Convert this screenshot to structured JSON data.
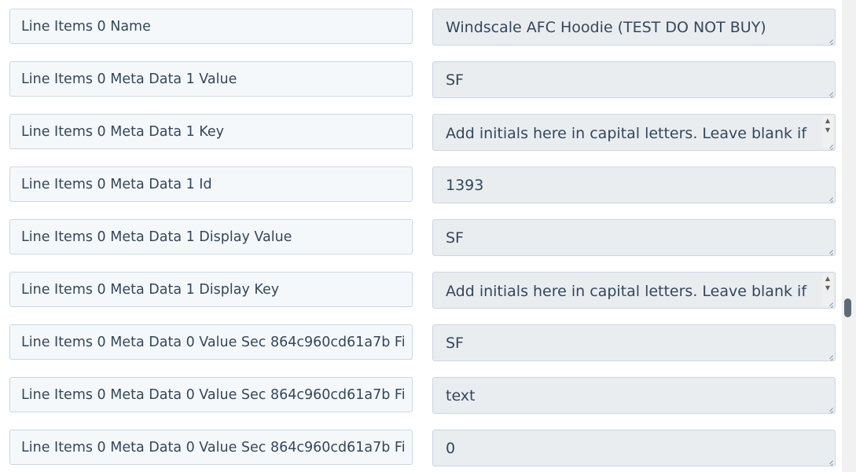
{
  "rows": [
    {
      "label": "Line Items 0 Name",
      "value": "Windscale AFC Hoodie (TEST DO NOT BUY)"
    },
    {
      "label": "Line Items 0 Meta Data 1 Value",
      "value": "SF"
    },
    {
      "label": "Line Items 0 Meta Data 1 Key",
      "value": "Add initials here in capital letters. Leave blank if no"
    },
    {
      "label": "Line Items 0 Meta Data 1 Id",
      "value": "1393"
    },
    {
      "label": "Line Items 0 Meta Data 1 Display Value",
      "value": "SF"
    },
    {
      "label": "Line Items 0 Meta Data 1 Display Key",
      "value": "Add initials here in capital letters. Leave blank if no"
    },
    {
      "label": "Line Items 0 Meta Data 0 Value Sec 864c960cd61a7b Fi",
      "value": "SF"
    },
    {
      "label": "Line Items 0 Meta Data 0 Value Sec 864c960cd61a7b Fi",
      "value": "text"
    },
    {
      "label": "Line Items 0 Meta Data 0 Value Sec 864c960cd61a7b Fi",
      "value": "0"
    }
  ]
}
